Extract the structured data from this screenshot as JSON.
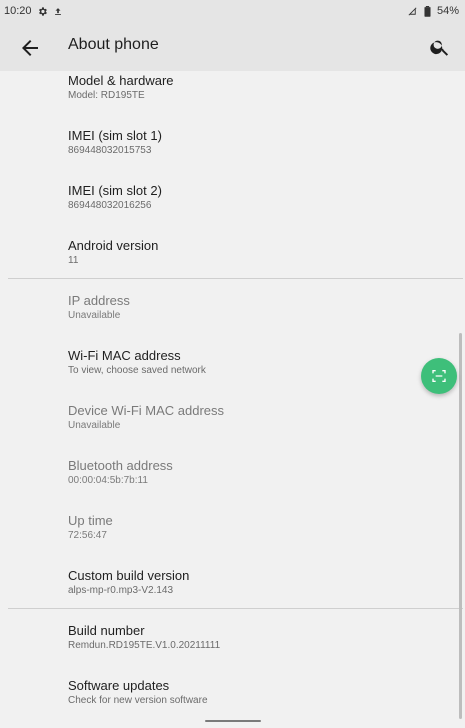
{
  "status_bar": {
    "time": "10:20",
    "battery": "54%"
  },
  "app_bar": {
    "title": "About phone"
  },
  "items": [
    {
      "title": "Model & hardware",
      "subtitle": "Model: RD195TE"
    },
    {
      "title": "IMEI (sim slot 1)",
      "subtitle": "869448032015753"
    },
    {
      "title": "IMEI (sim slot 2)",
      "subtitle": "869448032016256"
    },
    {
      "title": "Android version",
      "subtitle": "11"
    },
    {
      "title": "IP address",
      "subtitle": "Unavailable"
    },
    {
      "title": "Wi-Fi MAC address",
      "subtitle": "To view, choose saved network"
    },
    {
      "title": "Device Wi-Fi MAC address",
      "subtitle": "Unavailable"
    },
    {
      "title": "Bluetooth address",
      "subtitle": "00:00:04:5b:7b:11"
    },
    {
      "title": "Up time",
      "subtitle": "72:56:47"
    },
    {
      "title": "Custom build version",
      "subtitle": "alps-mp-r0.mp3-V2.143"
    },
    {
      "title": "Build number",
      "subtitle": "Remdun.RD195TE.V1.0.20211111"
    },
    {
      "title": "Software updates",
      "subtitle": "Check for new version software"
    }
  ],
  "icons": {
    "back": "arrow-back-icon",
    "search": "search-icon",
    "fab": "scan-icon",
    "status_left": [
      "settings-gear-icon",
      "upload-icon"
    ],
    "status_right": [
      "no-signal-icon",
      "battery-icon"
    ]
  },
  "colors": {
    "fab": "#3ebf7a",
    "bar": "#e5e5e5",
    "background": "#f1f1f1"
  }
}
